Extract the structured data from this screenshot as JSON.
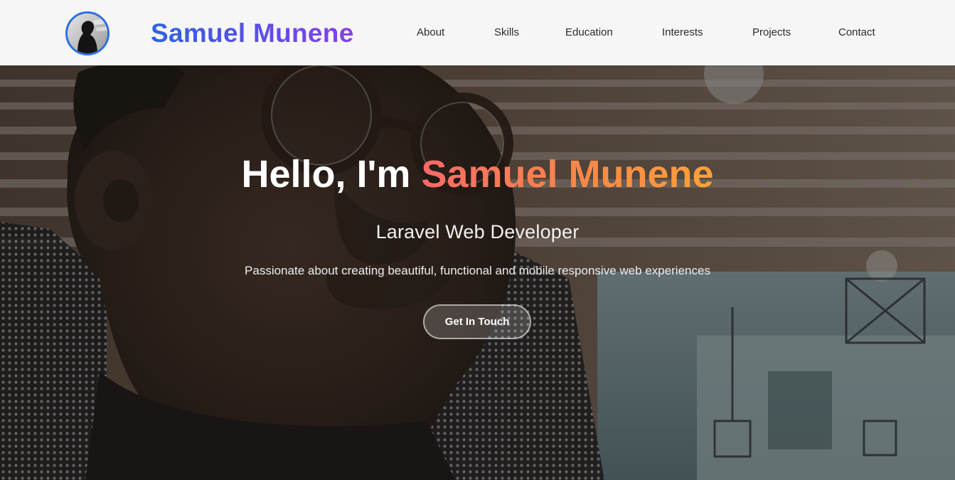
{
  "header": {
    "brand": "Samuel Munene",
    "nav": [
      "About",
      "Skills",
      "Education",
      "Interests",
      "Projects",
      "Contact"
    ]
  },
  "hero": {
    "greeting": "Hello, I'm",
    "name": "Samuel Munene",
    "role": "Laravel Web Developer",
    "tagline": "Passionate about creating beautiful, functional and mobile responsive web experiences",
    "cta_label": "Get In Touch"
  },
  "colors": {
    "brand_gradient_start": "#2e63de",
    "brand_gradient_end": "#8a3fe8",
    "name_gradient_start": "#fb6a6a",
    "name_gradient_end": "#fca23a",
    "avatar_ring": "#2f6fe0",
    "header_bg": "#f6f6f6"
  },
  "icons": {
    "avatar": "profile-photo"
  }
}
